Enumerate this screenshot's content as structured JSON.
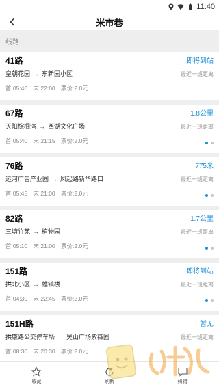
{
  "statusbar": {
    "time": "11:40"
  },
  "nav": {
    "title": "米市巷"
  },
  "section": {
    "label": "线路"
  },
  "routes": [
    {
      "name": "41路",
      "status": "即将到站",
      "from": "皇朝花园",
      "to": "东新园小区",
      "sub": "最近一班距离",
      "first": "首 05:40",
      "last": "末 22:00",
      "fare": "票价:2.0元",
      "dots": false
    },
    {
      "name": "67路",
      "status": "1.8公里",
      "from": "天阳棕榈湾",
      "to": "西湖文化广场",
      "sub": "最近一班距离",
      "first": "首 05:40",
      "last": "末 21:15",
      "fare": "票价:2.0元",
      "dots": true
    },
    {
      "name": "76路",
      "status": "775米",
      "from": "运河广告产业园",
      "to": "凤起路新华路口",
      "sub": "最近一班距离",
      "first": "首 05:45",
      "last": "末 21:00",
      "fare": "票价:2.0元",
      "dots": true
    },
    {
      "name": "82路",
      "status": "1.7公里",
      "from": "三塘竹苑",
      "to": "植物园",
      "sub": "最近一班距离",
      "first": "首 05:10",
      "last": "末 21:00",
      "fare": "票价:2.0元",
      "dots": true
    },
    {
      "name": "151路",
      "status": "即将到站",
      "from": "拱北小区",
      "to": "雄镇楼",
      "sub": "最近一班距离",
      "first": "首 04:30",
      "last": "末 22:45",
      "fare": "票价:2.0元",
      "dots": true
    },
    {
      "name": "151H路",
      "status": "暂无",
      "from": "拱康路公交停车场",
      "to": "吴山广场紫薇园",
      "sub": "最近一班距离",
      "first": "首 08:30",
      "last": "末 20:30",
      "fare": "票价:2.0元",
      "dots": true
    }
  ],
  "tabs": {
    "favorite": "收藏",
    "refresh": "刷新",
    "report": "纠错"
  },
  "colors": {
    "accent": "#1e90d6",
    "background": "#eeeeee"
  }
}
